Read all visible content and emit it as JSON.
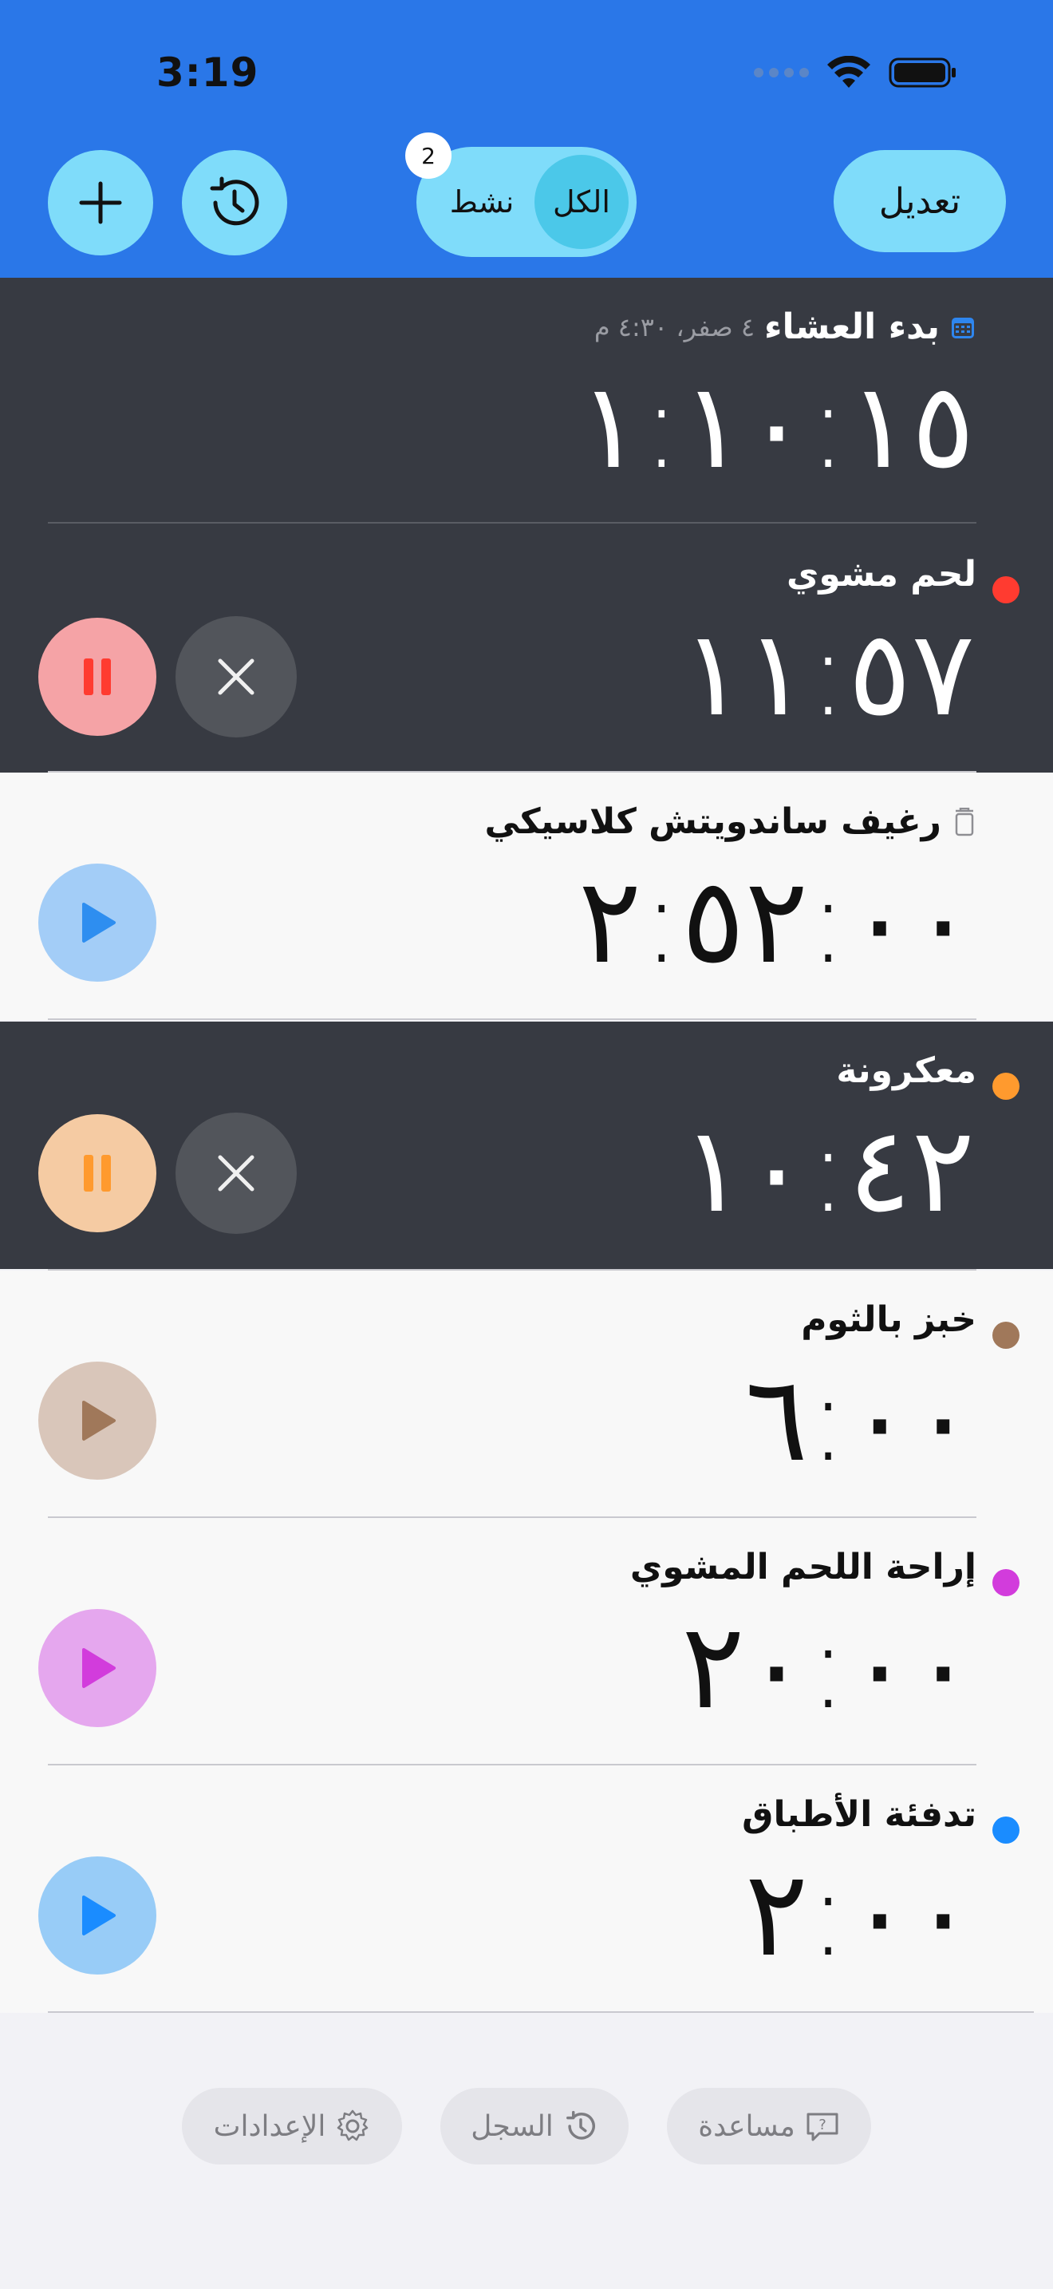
{
  "status": {
    "time": "3:19"
  },
  "header": {
    "edit_label": "تعديل",
    "segment_all": "الكل",
    "segment_active": "نشط",
    "active_count": "2",
    "accent": "#2a77e8"
  },
  "timers": [
    {
      "name": "بدء العشاء",
      "subtitle": "٤ صفر، ٤:٣٠ م",
      "time": "١:١٠:١٥",
      "state": "scheduled",
      "icon": "calendar-icon",
      "theme": "dark"
    },
    {
      "name": "لحم مشوي",
      "time": "١١:٥٧",
      "state": "running",
      "color": "#ff3b30",
      "theme": "dark"
    },
    {
      "name": "رغيف ساندويتش كلاسيكي",
      "time": "٢:٥٢:٠٠",
      "state": "idle",
      "icon": "trash-icon",
      "color": "#2e8ef0",
      "theme": "light"
    },
    {
      "name": "معكرونة",
      "time": "١٠:٤٢",
      "state": "running",
      "color": "#ff9a2e",
      "theme": "dark"
    },
    {
      "name": "خبز بالثوم",
      "time": "٦:٠٠",
      "state": "idle",
      "color": "#a0785a",
      "theme": "light"
    },
    {
      "name": "إراحة اللحم المشوي",
      "time": "٢٠:٠٠",
      "state": "idle",
      "color": "#d23cdc",
      "theme": "light"
    },
    {
      "name": "تدفئة الأطباق",
      "time": "٢:٠٠",
      "state": "idle",
      "color": "#1a8cff",
      "theme": "light"
    }
  ],
  "footer": {
    "help_label": "مساعدة",
    "history_label": "السجل",
    "settings_label": "الإعدادات"
  }
}
